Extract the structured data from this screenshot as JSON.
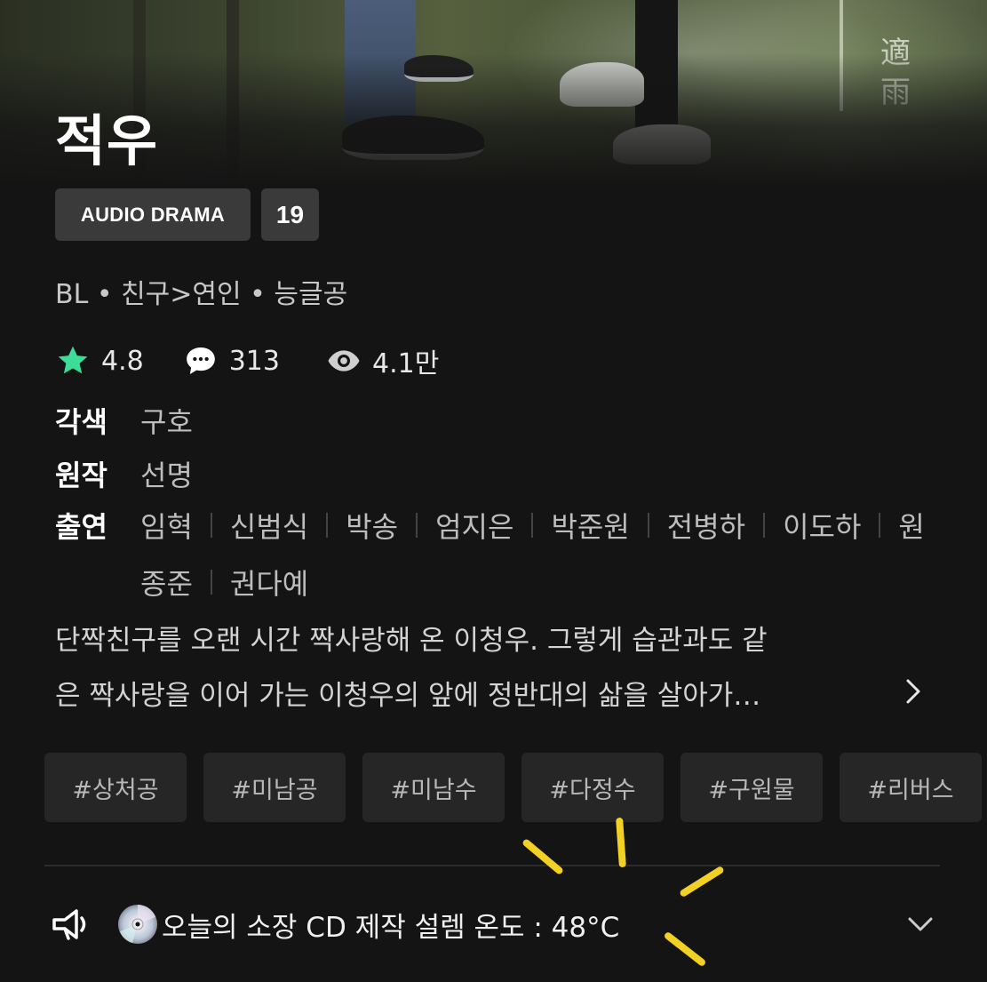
{
  "hero": {
    "hanja": [
      "適",
      "雨"
    ]
  },
  "title": "적우",
  "badges": {
    "format": "AUDIO DRAMA",
    "age": "19"
  },
  "genre": "BL • 친구>연인 • 능글공",
  "stats": {
    "rating": "4.8",
    "comments": "313",
    "views": "4.1만"
  },
  "credits": {
    "adaptation": {
      "label": "각색",
      "value": "구호"
    },
    "original": {
      "label": "원작",
      "value": "선명"
    },
    "cast": {
      "label": "출연",
      "row1": [
        "임혁",
        "신범식",
        "박송",
        "엄지은",
        "박준원",
        "전병하",
        "이도하",
        "원"
      ],
      "row2": [
        "종준",
        "권다예"
      ]
    }
  },
  "synopsis": {
    "line1": "단짝친구를 오랜 시간 짝사랑해 온 이청우. 그렇게 습관과도 같",
    "line2": "은 짝사랑을 이어 가는 이청우의 앞에 정반대의 삶을 살아가…"
  },
  "tags": [
    "#상처공",
    "#미남공",
    "#미남수",
    "#다정수",
    "#구원물",
    "#리버스"
  ],
  "notice": {
    "text": "오늘의 소장 CD 제작 설렘 온도 : 48°C"
  },
  "colors": {
    "background": "#141414",
    "star": "#3ddc97",
    "badge": "#3a3a3a",
    "tag": "#262626",
    "sparkle": "#f2d024"
  },
  "icons": [
    "star-icon",
    "comment-icon",
    "eye-icon",
    "chevron-right-icon",
    "speaker-icon",
    "cd-icon",
    "chevron-down-icon"
  ]
}
